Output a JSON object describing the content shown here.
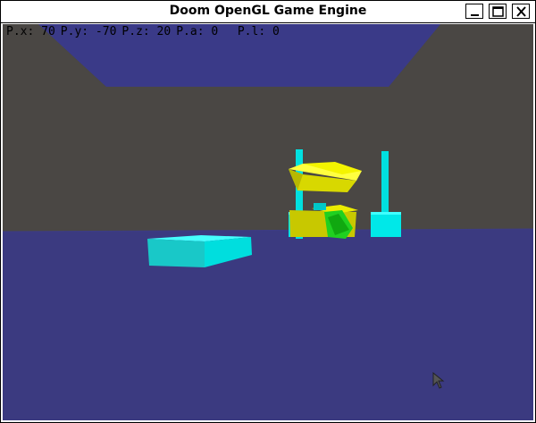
{
  "window": {
    "title": "Doom OpenGL Game Engine",
    "buttons": [
      "minimize",
      "maximize",
      "close"
    ]
  },
  "hud": {
    "px": "P.x: 70",
    "py": "P.y: -70",
    "pz": "P.z: 20",
    "pa": "P.a: 0",
    "pl": "P.l: 0"
  },
  "scene": {
    "colors": {
      "floor": "#3b3a80",
      "ceiling": "#3a3a88",
      "wall": "#4a4744",
      "cyan": "#00e8e8",
      "yellow": "#e8e800",
      "green": "#20d020"
    },
    "objects": [
      "cyan-slab",
      "left-pillar",
      "right-pillar",
      "yellow-block-top",
      "yellow-block-bottom",
      "green-item"
    ]
  }
}
